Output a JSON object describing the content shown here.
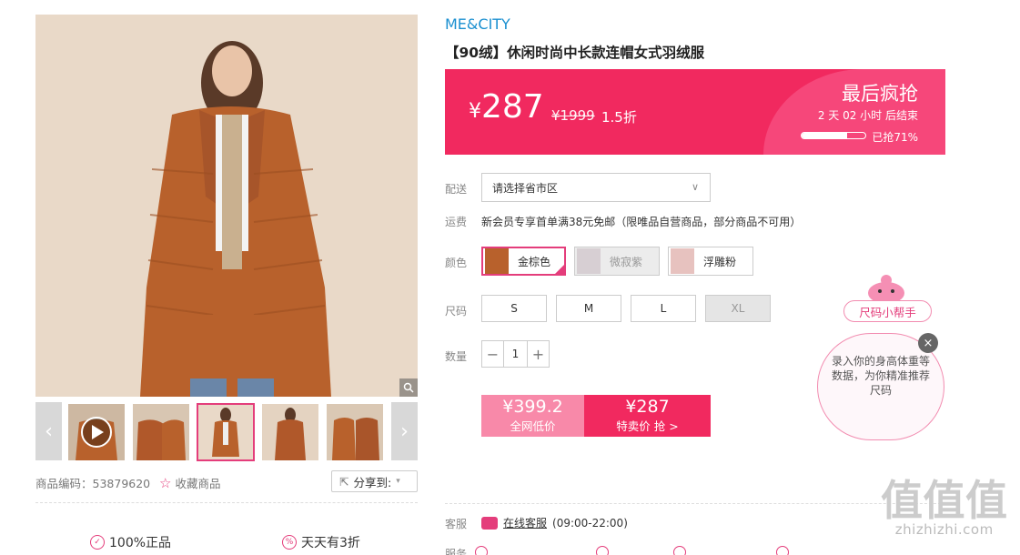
{
  "gallery": {
    "zoom_icon": "magnifier-icon",
    "prev_icon": "chevron-left-icon",
    "next_icon": "chevron-right-icon",
    "play_icon": "play-icon"
  },
  "meta": {
    "code_label": "商品编码：",
    "code": "53879620",
    "favorite": "收藏商品",
    "share": "分享到:"
  },
  "guarantees": [
    "100%正品",
    "天天有3折"
  ],
  "product": {
    "brand": "ME&CITY",
    "title": "【90绒】休闲时尚中长款连帽女式羽绒服"
  },
  "banner": {
    "currency": "¥",
    "price": "287",
    "original": "¥1999",
    "discount": "1.5折",
    "flash_title": "最后疯抢",
    "countdown": "2 天 02 小时 后结束",
    "sold_label": "已抢71%",
    "sold_fraction": 0.71
  },
  "delivery": {
    "label": "配送",
    "select": "请选择省市区"
  },
  "shipping": {
    "label": "运费",
    "text": "新会员专享首单满38元免邮（限唯品自营商品，部分商品不可用）"
  },
  "colors": {
    "label": "颜色",
    "options": [
      {
        "name": "金棕色",
        "selected": true
      },
      {
        "name": "微寂紫",
        "selected": false
      },
      {
        "name": "浮雕粉",
        "selected": false
      }
    ]
  },
  "sizes": {
    "label": "尺码",
    "options": [
      {
        "name": "S",
        "available": true
      },
      {
        "name": "M",
        "available": true
      },
      {
        "name": "L",
        "available": true
      },
      {
        "name": "XL",
        "available": false
      }
    ]
  },
  "quantity": {
    "label": "数量",
    "value": "1",
    "minus": "−",
    "plus": "+"
  },
  "buy": {
    "orig_price": "¥399.2",
    "orig_label": "全网低价",
    "sale_price": "¥287",
    "sale_label": "特卖价 抢 >"
  },
  "service": {
    "label": "客服",
    "link": "在线客服",
    "hours": "(09:00-22:00)"
  },
  "services_row": {
    "label": "服务"
  },
  "helper": {
    "button": "尺码小帮手",
    "text": "录入你的身高体重等数据，为你精准推荐尺码",
    "close": "×"
  },
  "watermark": {
    "glyphs": "值值值",
    "site": "zhizhizhi.com"
  },
  "colors_theme": {
    "accent": "#f1295f",
    "pink": "#e43d7b",
    "brand_blue": "#1a8fd0"
  }
}
